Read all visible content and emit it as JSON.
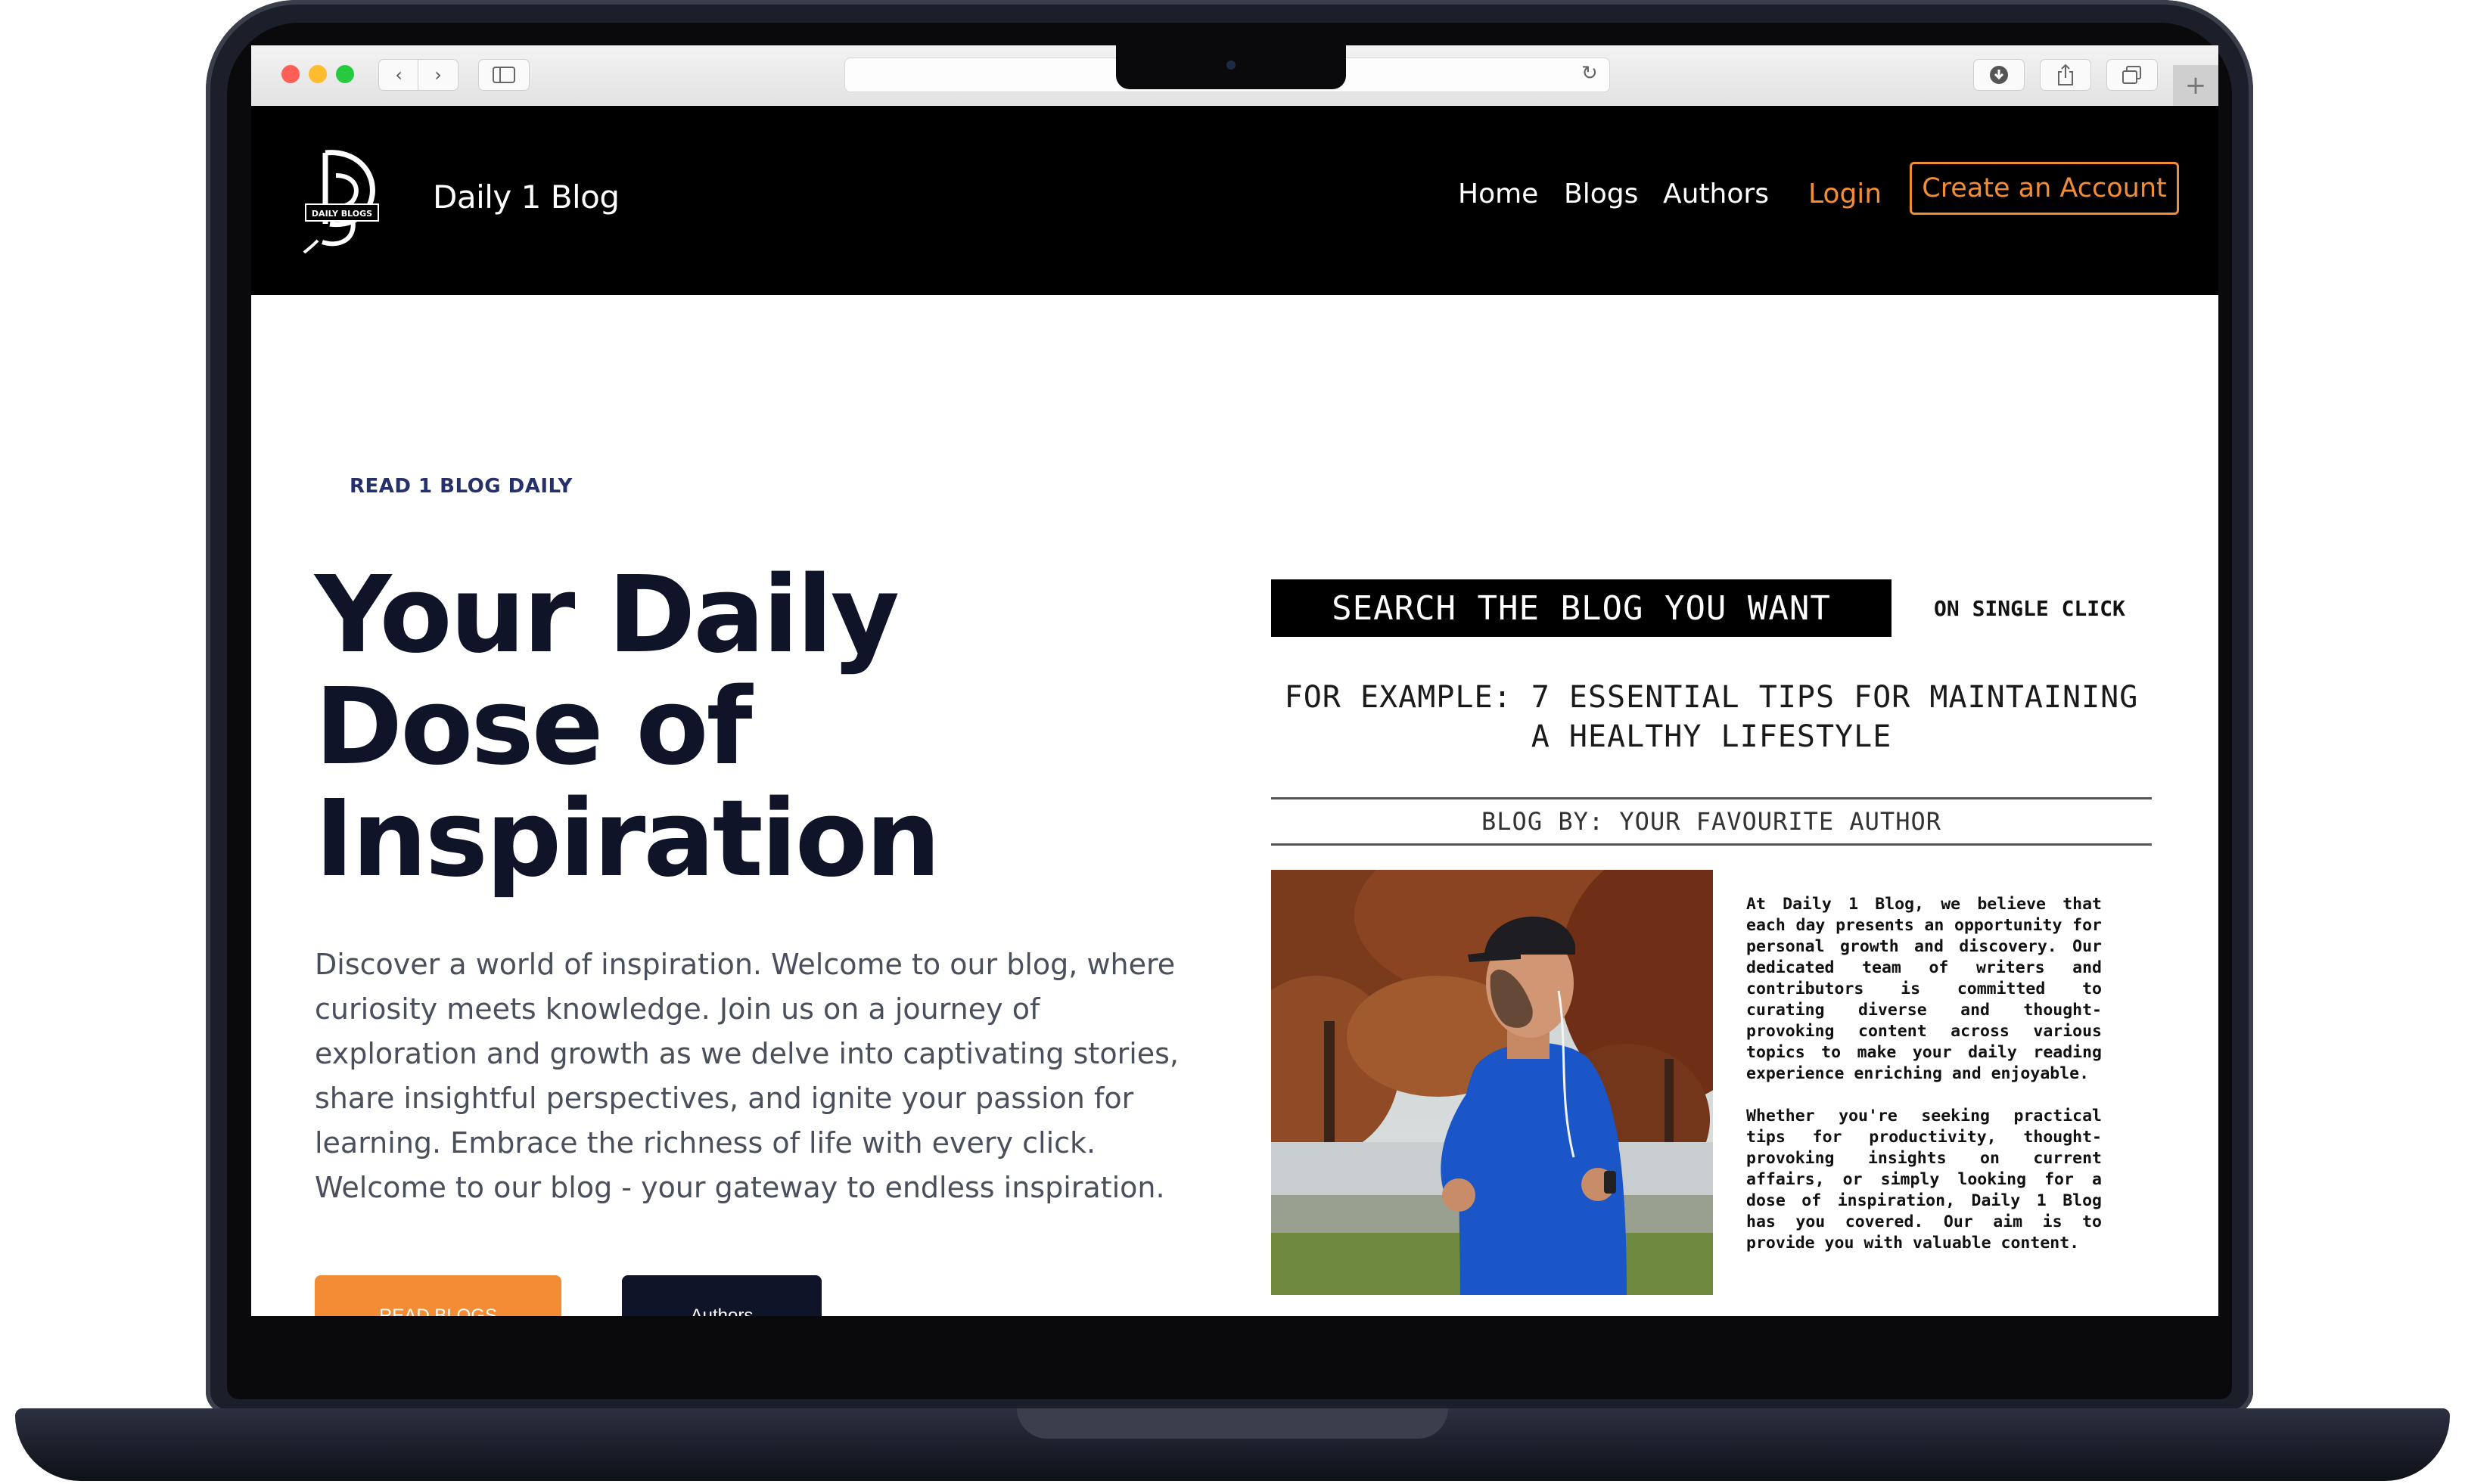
{
  "browser": {
    "address_value": "",
    "back_icon": "chevron-left-icon",
    "forward_icon": "chevron-right-icon",
    "sidebar_icon": "sidebar-icon",
    "reload_icon": "reload-icon",
    "download_icon": "download-icon",
    "share_icon": "share-icon",
    "tabs_icon": "tabs-icon",
    "new_tab_label": "+"
  },
  "site": {
    "brand": "Daily 1 Blog",
    "logo_text": "DAILY BLOGS",
    "nav": {
      "home": "Home",
      "blogs": "Blogs",
      "authors": "Authors",
      "login": "Login",
      "create_account": "Create an Account"
    },
    "colors": {
      "accent": "#f28d35",
      "dark": "#0f1428",
      "header_bg": "#000000"
    }
  },
  "hero": {
    "eyebrow": "READ 1 BLOG DAILY",
    "title": "Your Daily Dose of Inspiration",
    "body": "Discover a world of inspiration. Welcome to our blog, where curiosity meets knowledge. Join us on a journey of exploration and growth as we delve into captivating stories, share insightful perspectives, and ignite your passion for learning. Embrace the richness of life with every click. Welcome to our blog - your gateway to endless inspiration.",
    "cta_read": "READ BLOGS",
    "cta_authors": "Authors"
  },
  "feature": {
    "search_label": "SEARCH THE BLOG YOU WANT",
    "single_click": "ON SINGLE CLICK",
    "example": "FOR EXAMPLE: 7 ESSENTIAL TIPS FOR MAINTAINING A HEALTHY LIFESTYLE",
    "byline": "BLOG BY: YOUR FAVOURITE AUTHOR",
    "about_p1": "At Daily 1 Blog, we believe that each day presents an opportunity for personal growth and discovery. Our dedicated team of writers and contributors is committed to curating diverse and thought-provoking content across various topics to make your daily reading experience enriching and enjoyable.",
    "about_p2": "Whether you're seeking practical tips for productivity, thought-provoking insights on current affairs, or simply looking for a dose of inspiration, Daily 1 Blog has you covered. Our aim is to provide you with valuable content."
  }
}
